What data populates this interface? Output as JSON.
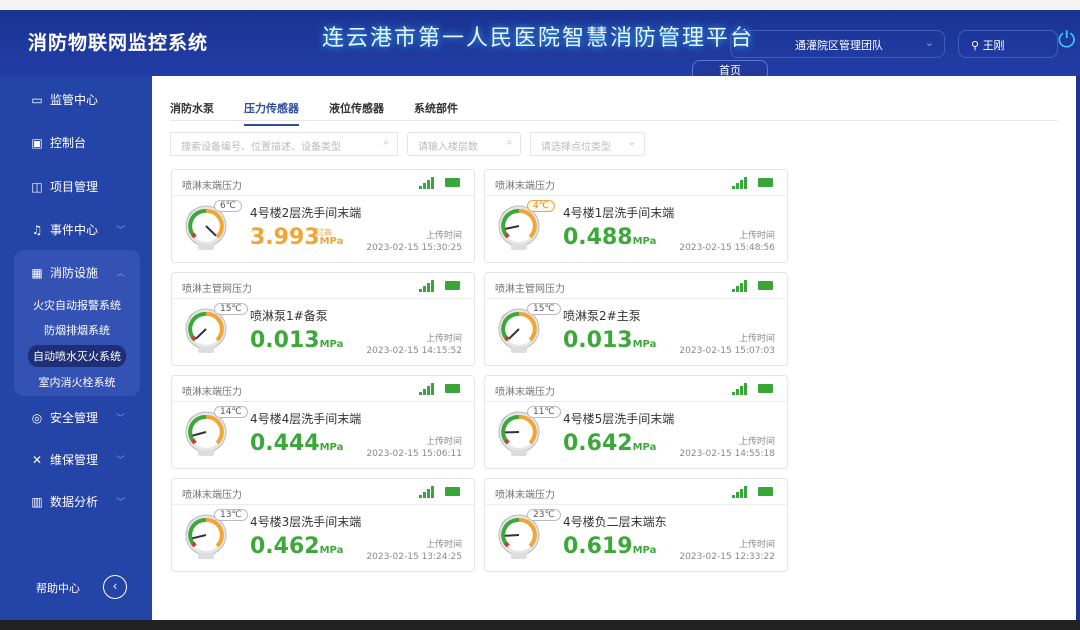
{
  "header": {
    "brand": "消防物联网监控系统",
    "title": "连云港市第一人民医院智慧消防管理平台",
    "team": "通灌院区管理团队",
    "user": "王刚",
    "home_tab": "首页"
  },
  "sidebar": {
    "items": [
      {
        "label": "监管中心",
        "icon": "monitor-icon"
      },
      {
        "label": "控制台",
        "icon": "console-icon"
      },
      {
        "label": "项目管理",
        "icon": "project-icon"
      },
      {
        "label": "事件中心",
        "icon": "bell-icon"
      },
      {
        "label": "消防设施",
        "icon": "grid-icon"
      },
      {
        "label": "安全管理",
        "icon": "target-icon"
      },
      {
        "label": "维保管理",
        "icon": "tools-icon"
      },
      {
        "label": "数据分析",
        "icon": "chart-icon"
      }
    ],
    "subitems": [
      "火灾自动报警系统",
      "防烟排烟系统",
      "自动喷水灭火系统",
      "室内消火栓系统"
    ],
    "active_sub": "自动喷水灭火系统",
    "help": "帮助中心"
  },
  "tabs": [
    "消防水泵",
    "压力传感器",
    "液位传感器",
    "系统部件"
  ],
  "active_tab": "压力传感器",
  "filters": {
    "search_placeholder": "搜索设备编号、位置描述、设备类型",
    "floor_placeholder": "请输入楼层数",
    "type_placeholder": "请选择点位类型"
  },
  "upload_label": "上传时间",
  "unit": "MPa",
  "over_label": "过高",
  "cards": [
    {
      "type": "喷淋末端压力",
      "location": "4号楼2层洗手间末端",
      "temp": "6℃",
      "value": "3.993",
      "time": "2023-02-15 15:30:25",
      "status": "high"
    },
    {
      "type": "喷淋末端压力",
      "location": "4号楼1层洗手间末端",
      "temp": "4℃",
      "value": "0.488",
      "time": "2023-02-15 15:48:56",
      "status": "normal"
    },
    {
      "type": "喷淋主管网压力",
      "location": "喷淋泵1#备泵",
      "temp": "15℃",
      "value": "0.013",
      "time": "2023-02-15 14:15:52",
      "status": "normal"
    },
    {
      "type": "喷淋主管网压力",
      "location": "喷淋泵2#主泵",
      "temp": "15℃",
      "value": "0.013",
      "time": "2023-02-15 15:07:03",
      "status": "normal"
    },
    {
      "type": "喷淋末端压力",
      "location": "4号楼4层洗手间末端",
      "temp": "14℃",
      "value": "0.444",
      "time": "2023-02-15 15:06:11",
      "status": "normal"
    },
    {
      "type": "喷淋末端压力",
      "location": "4号楼5层洗手间末端",
      "temp": "11℃",
      "value": "0.642",
      "time": "2023-02-15 14:55:18",
      "status": "normal"
    },
    {
      "type": "喷淋末端压力",
      "location": "4号楼3层洗手间末端",
      "temp": "13℃",
      "value": "0.462",
      "time": "2023-02-15 13:24:25",
      "status": "normal"
    },
    {
      "type": "喷淋末端压力",
      "location": "4号楼负二层末端东",
      "temp": "23℃",
      "value": "0.619",
      "time": "2023-02-15 12:33:22",
      "status": "normal"
    }
  ],
  "colors": {
    "sidebar": "#2544a8",
    "header": "#1a3393",
    "ok": "#3da83a",
    "warn": "#efa634",
    "active_tab": "#2f4e9e"
  }
}
